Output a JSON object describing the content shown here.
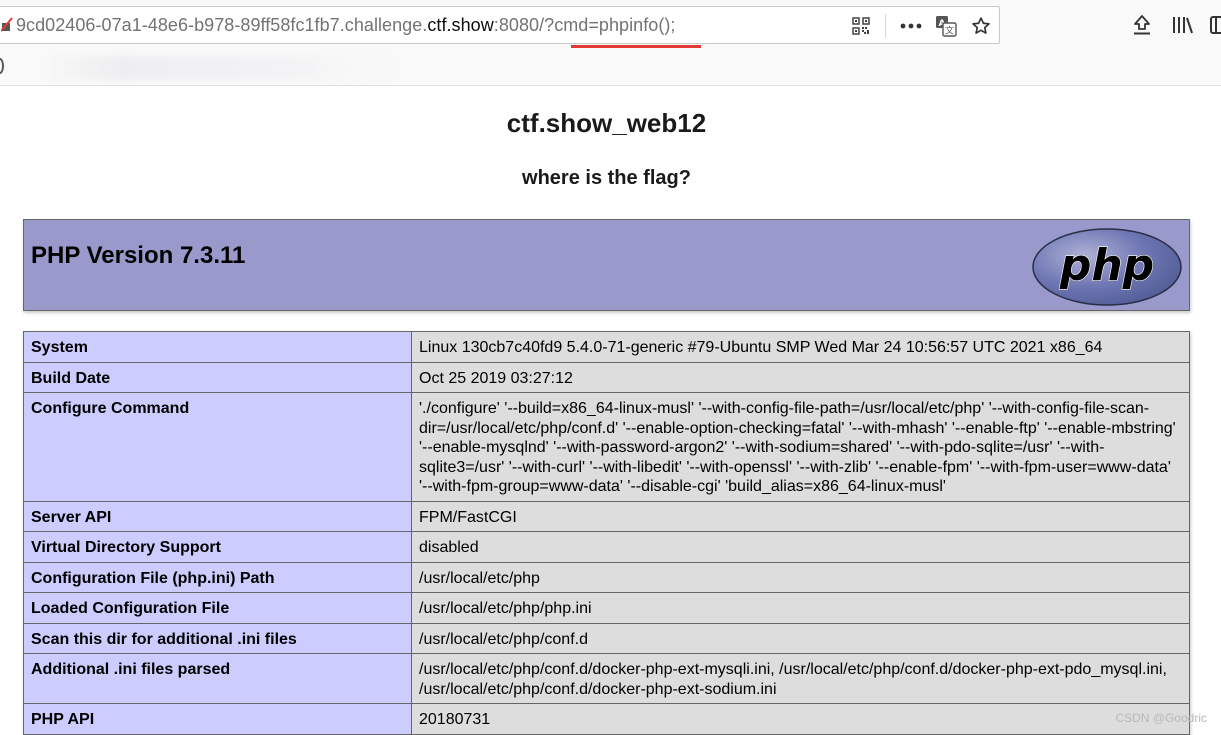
{
  "browser": {
    "url_prefix": "9cd02406-07a1-48e6-b978-89ff58fc1fb7.challenge.",
    "url_domain": "ctf.show",
    "url_suffix": ":8080/?cmd=phpinfo();",
    "icons": [
      "qr-code-icon",
      "more-icon",
      "translate-icon",
      "star-icon",
      "downloads-icon",
      "library-icon",
      "sidebar-icon"
    ],
    "accent_color": "#e53935"
  },
  "page": {
    "title": "ctf.show_web12",
    "subtitle": "where is the flag?"
  },
  "php": {
    "version_label": "PHP Version 7.3.11",
    "logo_text": "php",
    "header_color": "#9999cc"
  },
  "info_rows": [
    {
      "key": "System",
      "value": "Linux 130cb7c40fd9 5.4.0-71-generic #79-Ubuntu SMP Wed Mar 24 10:56:57 UTC 2021 x86_64"
    },
    {
      "key": "Build Date",
      "value": "Oct 25 2019 03:27:12"
    },
    {
      "key": "Configure Command",
      "value": "'./configure' '--build=x86_64-linux-musl' '--with-config-file-path=/usr/local/etc/php' '--with-config-file-scan-dir=/usr/local/etc/php/conf.d' '--enable-option-checking=fatal' '--with-mhash' '--enable-ftp' '--enable-mbstring' '--enable-mysqlnd' '--with-password-argon2' '--with-sodium=shared' '--with-pdo-sqlite=/usr' '--with-sqlite3=/usr' '--with-curl' '--with-libedit' '--with-openssl' '--with-zlib' '--enable-fpm' '--with-fpm-user=www-data' '--with-fpm-group=www-data' '--disable-cgi' 'build_alias=x86_64-linux-musl'"
    },
    {
      "key": "Server API",
      "value": "FPM/FastCGI"
    },
    {
      "key": "Virtual Directory Support",
      "value": "disabled"
    },
    {
      "key": "Configuration File (php.ini) Path",
      "value": "/usr/local/etc/php"
    },
    {
      "key": "Loaded Configuration File",
      "value": "/usr/local/etc/php/php.ini"
    },
    {
      "key": "Scan this dir for additional .ini files",
      "value": "/usr/local/etc/php/conf.d"
    },
    {
      "key": "Additional .ini files parsed",
      "value": "/usr/local/etc/php/conf.d/docker-php-ext-mysqli.ini, /usr/local/etc/php/conf.d/docker-php-ext-pdo_mysql.ini, /usr/local/etc/php/conf.d/docker-php-ext-sodium.ini"
    },
    {
      "key": "PHP API",
      "value": "20180731"
    }
  ],
  "watermark": "CSDN @Goodric"
}
